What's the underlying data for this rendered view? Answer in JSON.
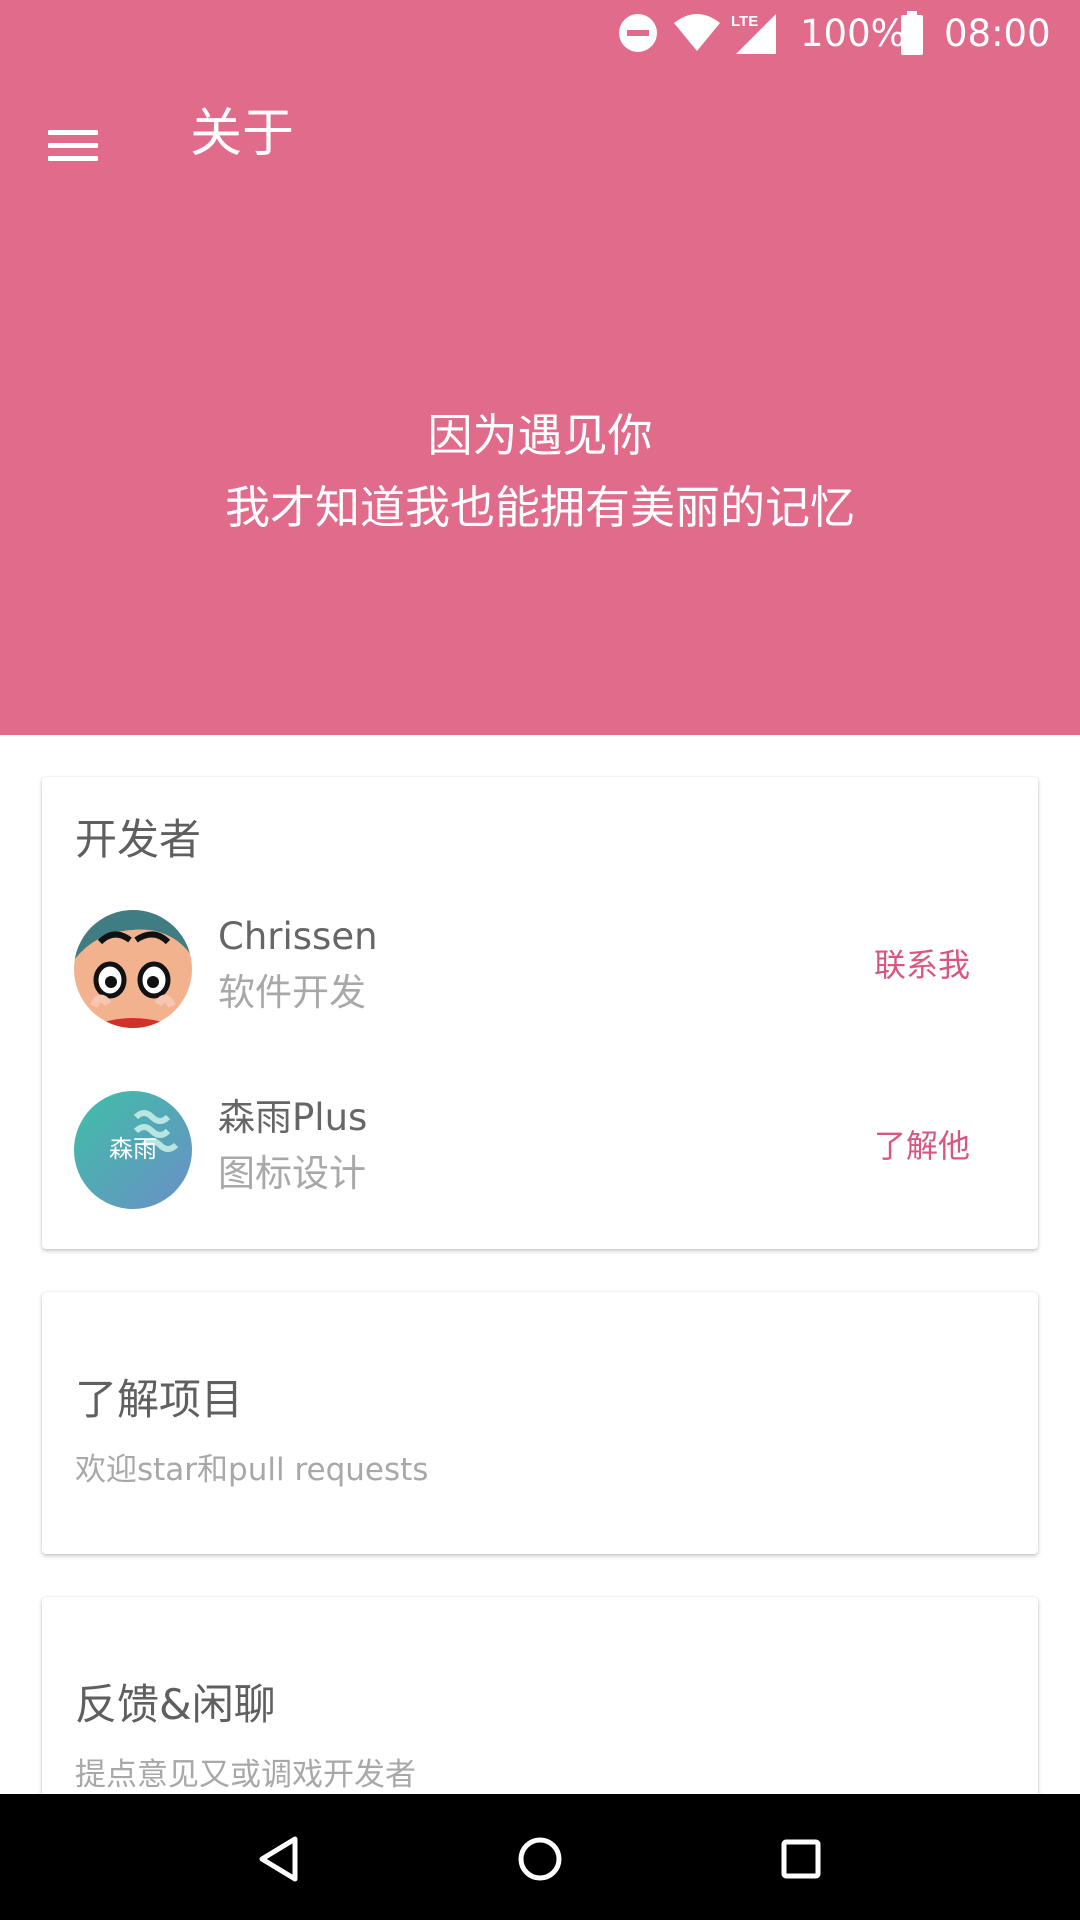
{
  "status_bar": {
    "battery": "100%",
    "time": "08:00",
    "icons": [
      "do-not-disturb-icon",
      "wifi-icon",
      "lte-signal-icon",
      "battery-icon"
    ]
  },
  "toolbar": {
    "title": "关于",
    "menu_icon": "menu-icon"
  },
  "hero": {
    "line1": "因为遇见你",
    "line2": "我才知道我也能拥有美丽的记忆"
  },
  "developers_card": {
    "title": "开发者",
    "developers": [
      {
        "name": "Chrissen",
        "role": "软件开发",
        "action": "联系我",
        "avatar": "cartoon-avatar"
      },
      {
        "name": "森雨Plus",
        "role": "图标设计",
        "action": "了解他",
        "avatar_text": "森雨"
      }
    ]
  },
  "project_card": {
    "title": "了解项目",
    "subtitle": "欢迎star和pull requests"
  },
  "feedback_card": {
    "title": "反馈&闲聊",
    "subtitle": "提点意见又或调戏开发者"
  },
  "nav_bar": {
    "icons": [
      "back-icon",
      "home-icon",
      "recents-icon"
    ]
  },
  "colors": {
    "primary": "#e06b8b",
    "accent_text": "#d8577f",
    "title_text": "#5f5f5f",
    "secondary_text": "#a8a8a8"
  }
}
